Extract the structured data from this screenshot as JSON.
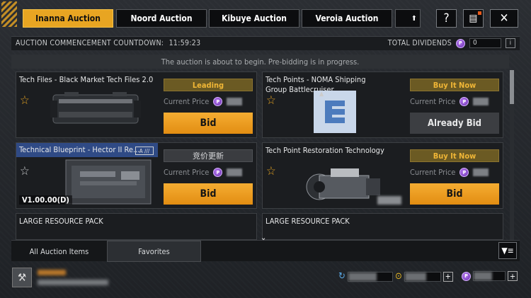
{
  "tabs": [
    {
      "label": "Inanna Auction",
      "active": true
    },
    {
      "label": "Noord Auction",
      "active": false
    },
    {
      "label": "Kibuye Auction",
      "active": false
    },
    {
      "label": "Veroia Auction",
      "active": false
    }
  ],
  "header": {
    "help_label": "?",
    "close_label": "✕"
  },
  "countdown": {
    "label": "AUCTION COMMENCEMENT COUNTDOWN:",
    "time": "11:59:23",
    "dividends_label": "TOTAL DIVIDENDS",
    "dividends_value": "0",
    "info_label": "i"
  },
  "notice": "The auction is about to begin. Pre-bidding is in progress.",
  "cards": [
    {
      "title": "Tech Files - Black Market Tech Files 2.0",
      "status": "Leading",
      "price_label": "Current Price",
      "action": "Bid"
    },
    {
      "title": "Tech Points - NOMA Shipping Group Battlecruiser",
      "status": "Buy It Now",
      "price_label": "Current Price",
      "action": "Already Bid"
    },
    {
      "title": "Technical Blueprint - Hector II Re...",
      "tag": "A ///",
      "price_overlay": "V1.00.00(D)",
      "status": "竞价更新",
      "price_label": "Current Price",
      "action": "Bid"
    },
    {
      "title": "Tech Point Restoration Technology",
      "status": "Buy It Now",
      "price_label": "Current Price",
      "action": "Bid"
    },
    {
      "title": "LARGE RESOURCE PACK"
    },
    {
      "title": "LARGE RESOURCE PACK"
    }
  ],
  "bottom_tabs": [
    {
      "label": "All Auction Items"
    },
    {
      "label": "Favorites"
    }
  ],
  "colors": {
    "accent": "#e8a522",
    "leading_bg": "#6b5a23",
    "coin": "#8e44d6",
    "highlight": "#2f4a85"
  },
  "icons": [
    "star-icon",
    "coin-icon",
    "refresh-icon",
    "token-icon",
    "filter-icon",
    "gavel-icon",
    "close-icon",
    "help-icon",
    "notes-icon",
    "chevron-down-icon"
  ]
}
